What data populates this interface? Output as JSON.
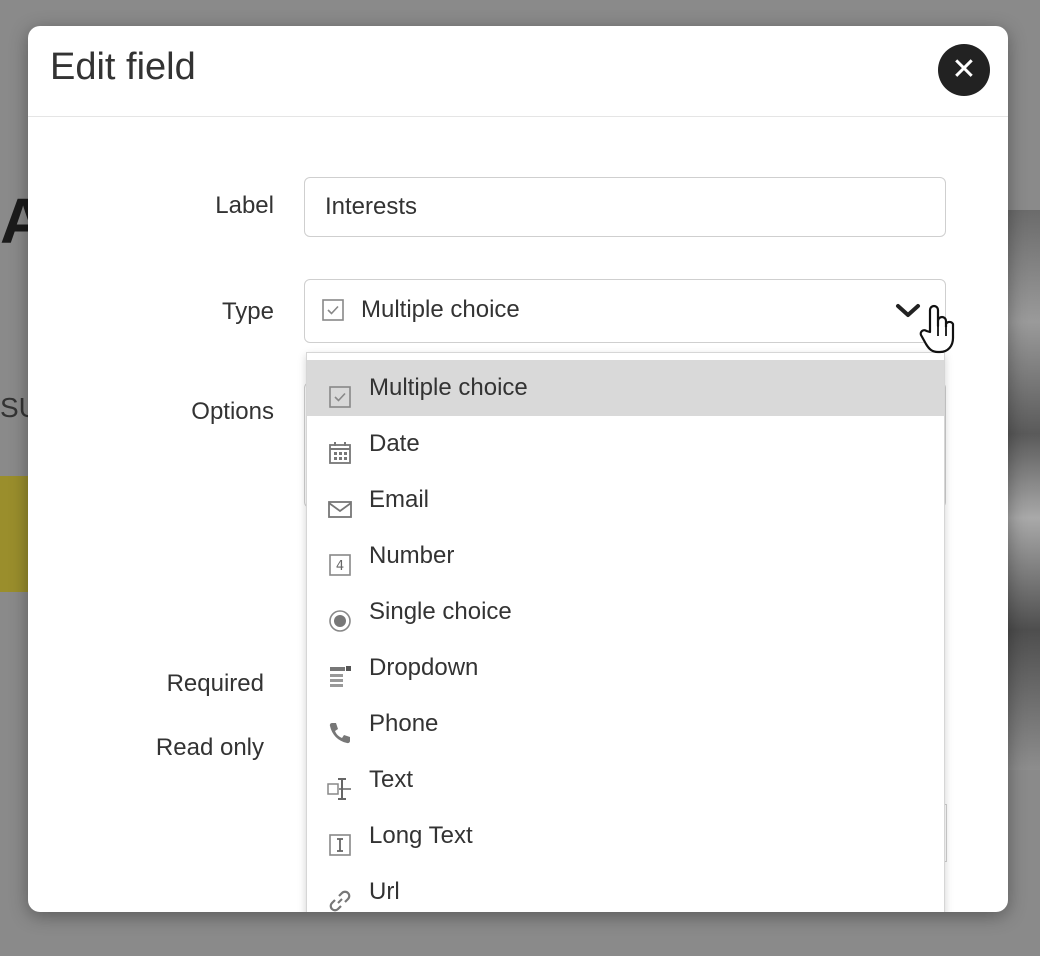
{
  "modal": {
    "title": "Edit field",
    "close_symbol": "✕"
  },
  "form": {
    "label_caption": "Label",
    "label_value": "Interests",
    "type_caption": "Type",
    "type_selected": "Multiple choice",
    "options_caption": "Options",
    "required_caption": "Required",
    "readonly_caption": "Read only"
  },
  "dropdown": {
    "items": [
      {
        "label": "Multiple choice",
        "icon": "checkbox-icon",
        "selected": true
      },
      {
        "label": "Date",
        "icon": "calendar-icon",
        "selected": false
      },
      {
        "label": "Email",
        "icon": "envelope-icon",
        "selected": false
      },
      {
        "label": "Number",
        "icon": "number-icon",
        "selected": false
      },
      {
        "label": "Single choice",
        "icon": "radio-icon",
        "selected": false
      },
      {
        "label": "Dropdown",
        "icon": "dropdown-list-icon",
        "selected": false
      },
      {
        "label": "Phone",
        "icon": "phone-icon",
        "selected": false
      },
      {
        "label": "Text",
        "icon": "text-cursor-icon",
        "selected": false
      },
      {
        "label": "Long Text",
        "icon": "textarea-icon",
        "selected": false
      },
      {
        "label": "Url",
        "icon": "link-icon",
        "selected": false
      }
    ]
  },
  "colors": {
    "selected_row": "#d9d9d9",
    "close_button": "#222222",
    "overlay": "#8a8a8a"
  }
}
